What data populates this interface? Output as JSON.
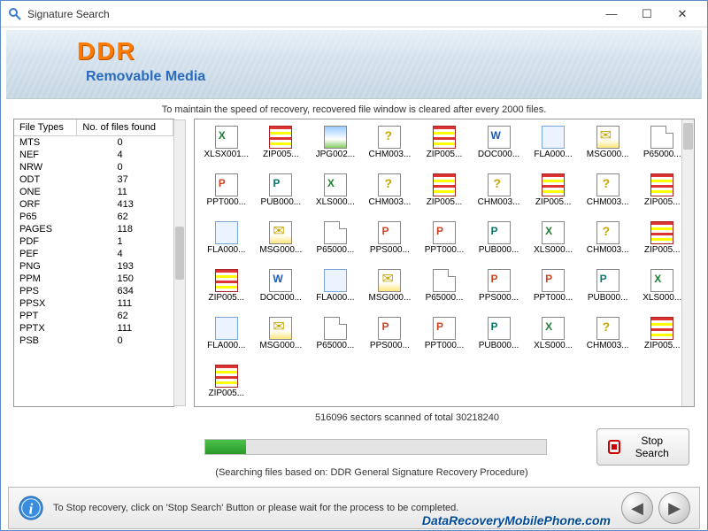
{
  "window": {
    "title": "Signature Search"
  },
  "banner": {
    "logo": "DDR",
    "subtitle": "Removable Media"
  },
  "notice": "To maintain the speed of recovery, recovered file window is cleared after every 2000 files.",
  "left_table": {
    "col1": "File Types",
    "col2": "No. of files found",
    "rows": [
      {
        "type": "MTS",
        "count": "0"
      },
      {
        "type": "NEF",
        "count": "4"
      },
      {
        "type": "NRW",
        "count": "0"
      },
      {
        "type": "ODT",
        "count": "37"
      },
      {
        "type": "ONE",
        "count": "11"
      },
      {
        "type": "ORF",
        "count": "413"
      },
      {
        "type": "P65",
        "count": "62"
      },
      {
        "type": "PAGES",
        "count": "118"
      },
      {
        "type": "PDF",
        "count": "1"
      },
      {
        "type": "PEF",
        "count": "4"
      },
      {
        "type": "PNG",
        "count": "193"
      },
      {
        "type": "PPM",
        "count": "150"
      },
      {
        "type": "PPS",
        "count": "634"
      },
      {
        "type": "PPSX",
        "count": "111"
      },
      {
        "type": "PPT",
        "count": "62"
      },
      {
        "type": "PPTX",
        "count": "111"
      },
      {
        "type": "PSB",
        "count": "0"
      }
    ]
  },
  "files": [
    {
      "label": "XLSX001...",
      "icon": "xls"
    },
    {
      "label": "ZIP005...",
      "icon": "zip"
    },
    {
      "label": "JPG002...",
      "icon": "jpg"
    },
    {
      "label": "CHM003...",
      "icon": "chm"
    },
    {
      "label": "ZIP005...",
      "icon": "zip"
    },
    {
      "label": "DOC000...",
      "icon": "doc"
    },
    {
      "label": "FLA000...",
      "icon": "note"
    },
    {
      "label": "MSG000...",
      "icon": "msg"
    },
    {
      "label": "P65000...",
      "icon": "blank"
    },
    {
      "label": "PPT000...",
      "icon": "ppt"
    },
    {
      "label": "PUB000...",
      "icon": "pub"
    },
    {
      "label": "XLS000...",
      "icon": "xls"
    },
    {
      "label": "CHM003...",
      "icon": "chm"
    },
    {
      "label": "ZIP005...",
      "icon": "zip"
    },
    {
      "label": "CHM003...",
      "icon": "chm"
    },
    {
      "label": "ZIP005...",
      "icon": "zip"
    },
    {
      "label": "CHM003...",
      "icon": "chm"
    },
    {
      "label": "ZIP005...",
      "icon": "zip"
    },
    {
      "label": "FLA000...",
      "icon": "note"
    },
    {
      "label": "MSG000...",
      "icon": "msg"
    },
    {
      "label": "P65000...",
      "icon": "blank"
    },
    {
      "label": "PPS000...",
      "icon": "ppt"
    },
    {
      "label": "PPT000...",
      "icon": "ppt"
    },
    {
      "label": "PUB000...",
      "icon": "pub"
    },
    {
      "label": "XLS000...",
      "icon": "xls"
    },
    {
      "label": "CHM003...",
      "icon": "chm"
    },
    {
      "label": "ZIP005...",
      "icon": "zip"
    },
    {
      "label": "ZIP005...",
      "icon": "zip"
    },
    {
      "label": "DOC000...",
      "icon": "doc"
    },
    {
      "label": "FLA000...",
      "icon": "note"
    },
    {
      "label": "MSG000...",
      "icon": "msg"
    },
    {
      "label": "P65000...",
      "icon": "blank"
    },
    {
      "label": "PPS000...",
      "icon": "ppt"
    },
    {
      "label": "PPT000...",
      "icon": "ppt"
    },
    {
      "label": "PUB000...",
      "icon": "pub"
    },
    {
      "label": "XLS000...",
      "icon": "xls"
    },
    {
      "label": "FLA000...",
      "icon": "note"
    },
    {
      "label": "MSG000...",
      "icon": "msg"
    },
    {
      "label": "P65000...",
      "icon": "blank"
    },
    {
      "label": "PPS000...",
      "icon": "ppt"
    },
    {
      "label": "PPT000...",
      "icon": "ppt"
    },
    {
      "label": "PUB000...",
      "icon": "pub"
    },
    {
      "label": "XLS000...",
      "icon": "xls"
    },
    {
      "label": "CHM003...",
      "icon": "chm"
    },
    {
      "label": "ZIP005...",
      "icon": "zip"
    },
    {
      "label": "ZIP005...",
      "icon": "zip"
    }
  ],
  "progress": {
    "label": "516096 sectors scanned of total 30218240",
    "stop_label": "Stop Search",
    "searching": "(Searching files based on:  DDR General Signature Recovery Procedure)"
  },
  "footer": {
    "message": "To Stop recovery, click on 'Stop Search' Button or please wait for the process to be completed.",
    "watermark": "DataRecoveryMobilePhone.com"
  }
}
